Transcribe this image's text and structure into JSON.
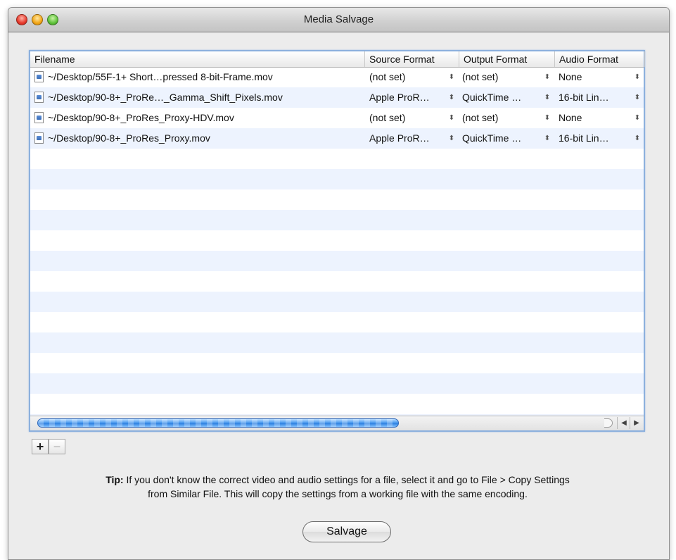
{
  "window": {
    "title": "Media Salvage"
  },
  "table": {
    "columns": [
      "Filename",
      "Source Format",
      "Output Format",
      "Audio Format"
    ],
    "rows": [
      {
        "filename": "~/Desktop/55F-1+ Short…pressed 8-bit-Frame.mov",
        "source": "(not set)",
        "output": "(not set)",
        "audio": "None"
      },
      {
        "filename": "~/Desktop/90-8+_ProRe…_Gamma_Shift_Pixels.mov",
        "source": "Apple ProR…",
        "output": "QuickTime …",
        "audio": "16-bit Lin…"
      },
      {
        "filename": "~/Desktop/90-8+_ProRes_Proxy-HDV.mov",
        "source": "(not set)",
        "output": "(not set)",
        "audio": "None"
      },
      {
        "filename": "~/Desktop/90-8+_ProRes_Proxy.mov",
        "source": "Apple ProR…",
        "output": "QuickTime …",
        "audio": "16-bit Lin…"
      }
    ]
  },
  "controls": {
    "add": "+",
    "remove": "−"
  },
  "tip": {
    "label": "Tip:",
    "line1": " If you don't know the correct video and audio settings for a file, select it and go to File > Copy Settings",
    "line2": "from Similar File. This will copy the settings from a working file with the same encoding."
  },
  "salvage_button": "Salvage",
  "colors": {
    "selection_stripe": "#edf3fe",
    "focus_ring": "#8cb0dd",
    "scroll_thumb": "#4e9cf0"
  }
}
